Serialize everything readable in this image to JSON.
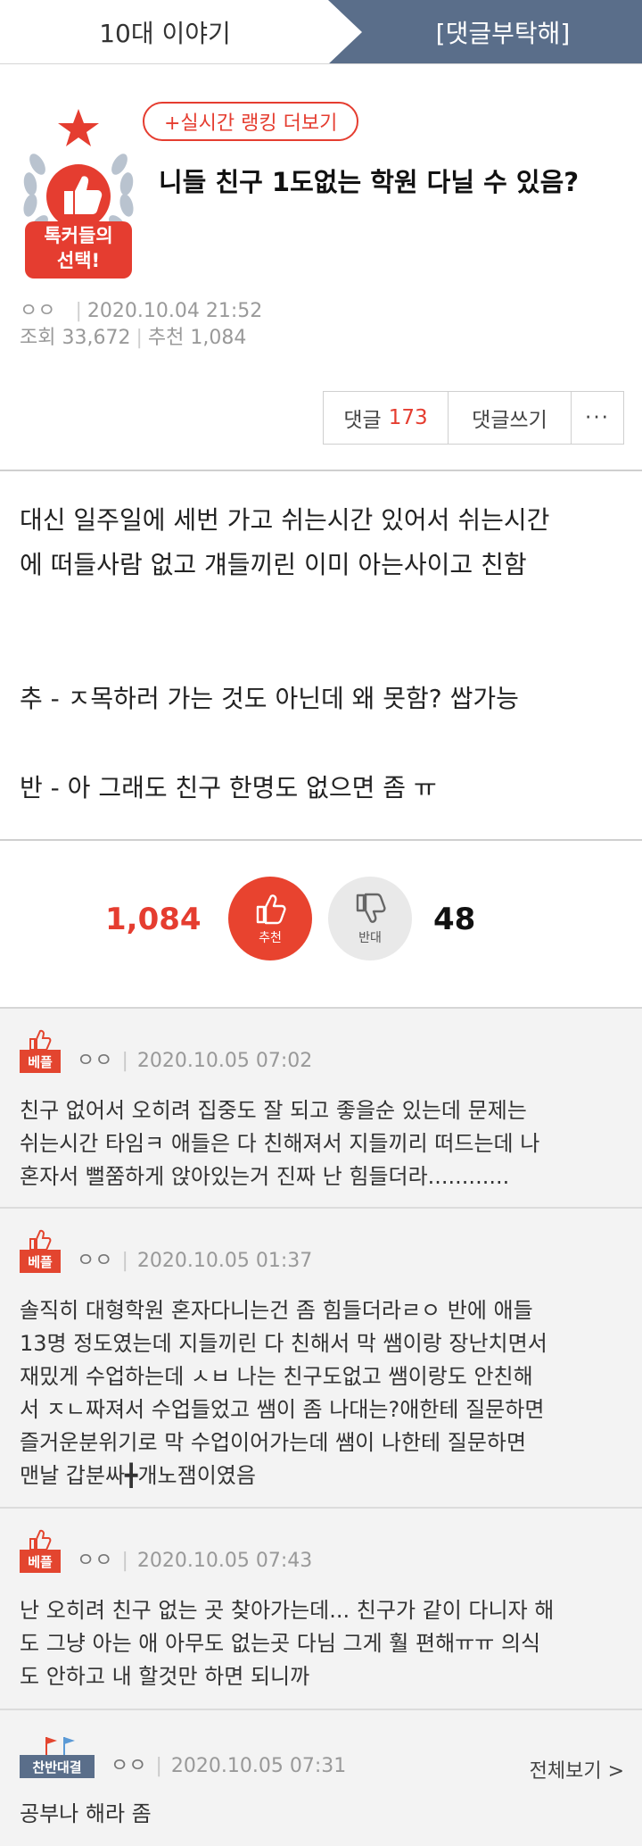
{
  "tabs": {
    "left": "10대 이야기",
    "right": "[댓글부탁해]"
  },
  "post": {
    "ranking_button": "+실시간 랭킹 더보기",
    "badge_line1": "톡커들의",
    "badge_line2": "선택!",
    "title": "니들 친구 1도없는 학원 다닐 수 있음?",
    "author": "ㅇㅇ",
    "date": "2020.10.04 21:52",
    "views_label": "조회",
    "views": "33,672",
    "recommend_label": "추천",
    "recommend": "1,084",
    "comment_label": "댓글",
    "comment_count": "173",
    "write_comment": "댓글쓰기",
    "more": "···",
    "body": [
      "대신 일주일에 세번 가고 쉬는시간 있어서 쉬는시간",
      "에 떠들사람 없고 걔들끼린 이미 아는사이고 친함",
      "",
      "",
      "추 - ㅈ목하러 가는 것도 아닌데 왜 못함? 쌉가능",
      "",
      "반 - 아 그래도 친구 한명도 없으면 좀 ㅠ"
    ]
  },
  "vote": {
    "up_count": "1,084",
    "up_label": "추천",
    "down_label": "반대",
    "down_count": "48"
  },
  "comments": [
    {
      "badge": "베플",
      "author": "ㅇㅇ",
      "time": "2020.10.05 07:02",
      "lines": [
        "친구 없어서 오히려 집중도 잘 되고 좋을순 있는데 문제는",
        "쉬는시간 타임ㅋ 애들은 다 친해져서 지들끼리 떠드는데 나",
        "혼자서 뻘쭘하게 앉아있는거 진짜 난 힘들더라............"
      ]
    },
    {
      "badge": "베플",
      "author": "ㅇㅇ",
      "time": "2020.10.05 01:37",
      "lines": [
        "솔직히 대형학원 혼자다니는건 좀 힘들더라ㄹㅇ 반에 애들",
        "13명 정도였는데 지들끼린 다 친해서 막 쌤이랑 장난치면서",
        "재밌게 수업하는데 ㅅㅂ 나는 친구도없고 쌤이랑도 안친해",
        "서 ㅈㄴ짜져서 수업들었고 쌤이 좀 나대는?애한테 질문하면",
        "즐거운분위기로 막 수업이어가는데 쌤이 나한테 질문하면",
        "맨날 갑분싸╋개노잼이였음"
      ]
    },
    {
      "badge": "베플",
      "author": "ㅇㅇ",
      "time": "2020.10.05 07:43",
      "lines": [
        "난 오히려 친구 없는 곳 찾아가는데... 친구가 같이 다니자 해",
        "도 그냥 아는 애 아무도 없는곳 다님 그게 훨 편해ㅠㅠ 의식",
        "도 안하고 내 할것만 하면 되니까"
      ]
    },
    {
      "badge": "찬반대결",
      "author": "ㅇㅇ",
      "time": "2020.10.05 07:31",
      "view_all": "전체보기 >",
      "lines": [
        "공부나 해라 좀"
      ]
    }
  ],
  "colors": {
    "accent_red": "#e53d30",
    "tab_blue": "#5a6e8a"
  }
}
